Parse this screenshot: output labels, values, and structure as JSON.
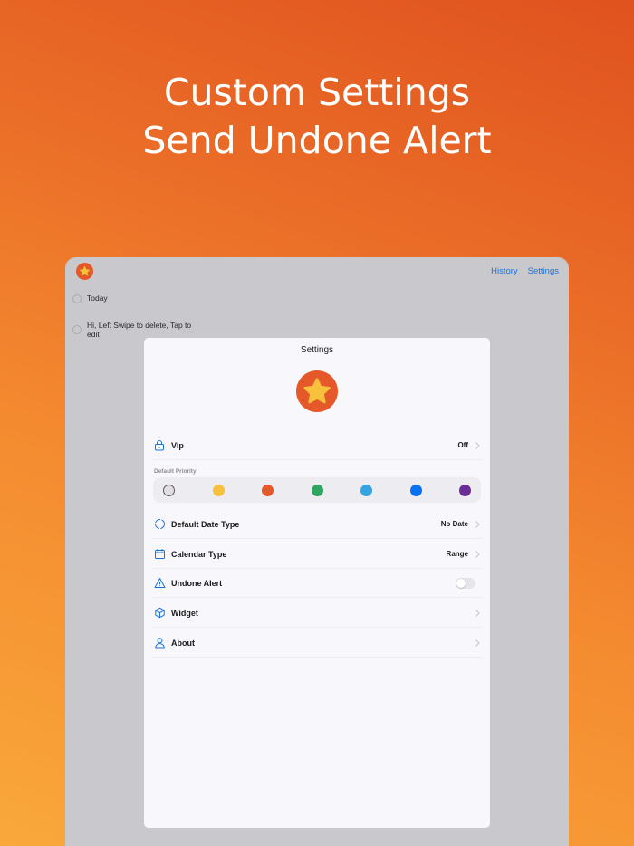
{
  "headline": {
    "line1": "Custom Settings",
    "line2": "Send Undone Alert"
  },
  "app": {
    "nav": {
      "history": "History",
      "settings": "Settings"
    },
    "list": [
      {
        "text": "Today"
      },
      {
        "text": "Hi,   Left Swipe to delete,   Tap to edit"
      }
    ]
  },
  "settings": {
    "title": "Settings",
    "vip": {
      "label": "Vip",
      "value": "Off"
    },
    "priority_label": "Default Priority",
    "priority_colors": [
      "#e1dde3",
      "#f7c13c",
      "#e4582a",
      "#2fa463",
      "#36a3e0",
      "#0a6ff0",
      "#6b2e95"
    ],
    "priority_selected": 0,
    "rows": {
      "date_type": {
        "label": "Default Date Type",
        "value": "No Date"
      },
      "calendar_type": {
        "label": "Calendar Type",
        "value": "Range"
      },
      "undone_alert": {
        "label": "Undone Alert",
        "enabled": false
      },
      "widget": {
        "label": "Widget"
      },
      "about": {
        "label": "About"
      }
    }
  },
  "colors": {
    "accent": "#1a73d9",
    "brand": "#e4582a",
    "star": "#f7c13c"
  }
}
